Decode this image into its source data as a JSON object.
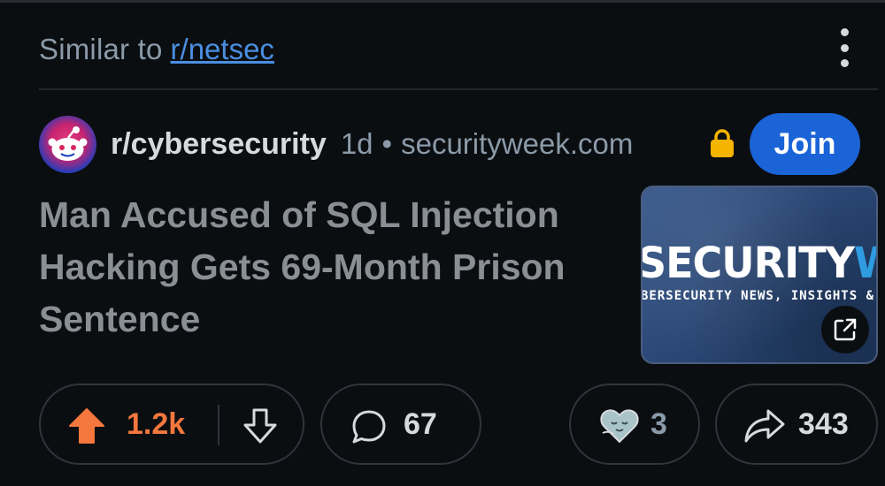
{
  "recommendation": {
    "prefix": "Similar to",
    "subreddit_link": "r/netsec"
  },
  "post": {
    "subreddit": "r/cybersecurity",
    "age": "1d",
    "separator": "•",
    "domain": "securityweek.com",
    "join_label": "Join",
    "title": "Man Accused of SQL Injection Hacking Gets 69-Month Prison Sentence",
    "thumbnail": {
      "logo_main": "SECURITYWEE",
      "logo_tagline": "BERSECURITY NEWS, INSIGHTS & ANALY"
    }
  },
  "actions": {
    "upvotes": "1.2k",
    "comments": "67",
    "awards": "3",
    "shares": "343"
  },
  "colors": {
    "background": "#0b0e11",
    "join_button": "#1a64d8",
    "upvote_active": "#f4773d",
    "link": "#4a8ee0",
    "lock": "#f5b400"
  },
  "icons": {
    "menu": "kebab-icon",
    "lock": "lock-icon",
    "upvote": "upvote-arrow-icon",
    "downvote": "downvote-arrow-icon",
    "comment": "comment-bubble-icon",
    "award": "award-heart-icon",
    "share": "share-arrow-icon",
    "external_link": "external-link-icon"
  }
}
